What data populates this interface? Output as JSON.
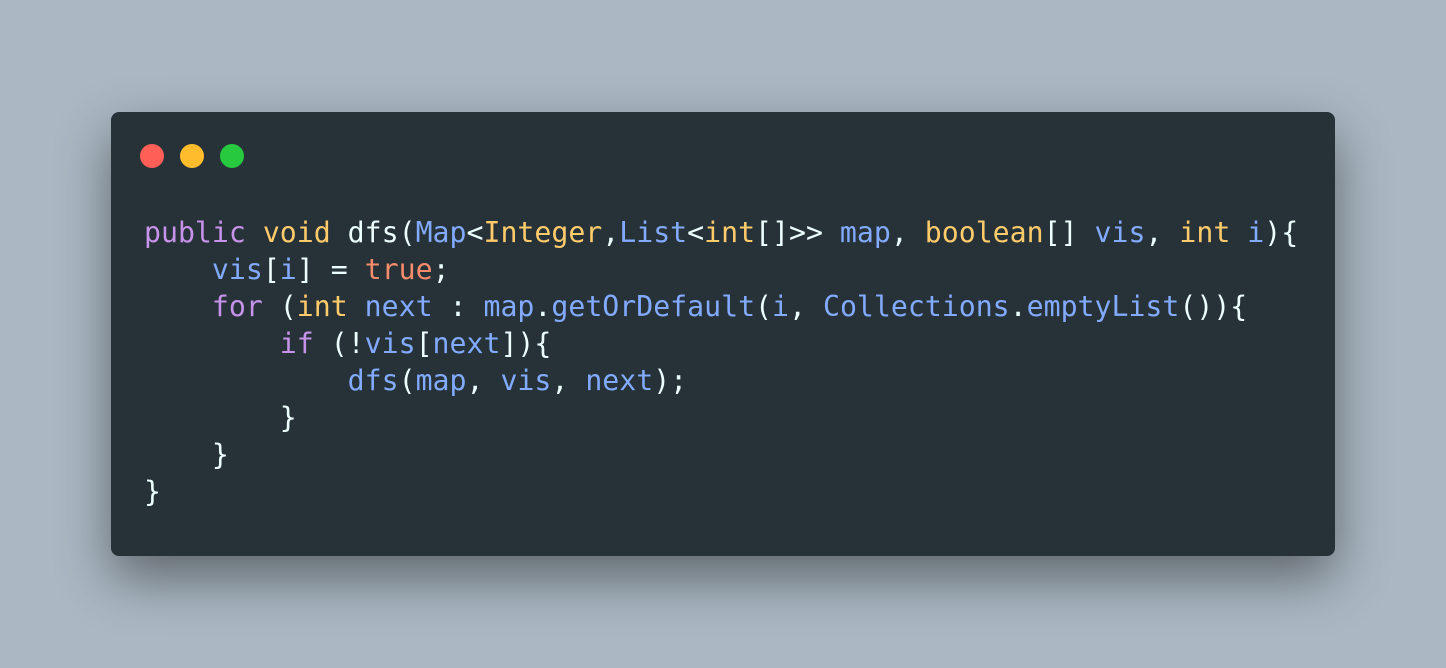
{
  "window": {
    "background": "#263238",
    "controls": [
      {
        "name": "close",
        "color": "#ff5f56"
      },
      {
        "name": "minimize",
        "color": "#ffbd2e"
      },
      {
        "name": "maximize",
        "color": "#27c93f"
      }
    ]
  },
  "theme": {
    "keyword": "#c792ea",
    "type": "#ffcb6b",
    "identifier": "#82aaff",
    "boolean": "#f78c6c",
    "punctuation": "#eeffff"
  },
  "code": {
    "language": "java",
    "lines": [
      [
        {
          "t": "public",
          "k": "keyword"
        },
        {
          "t": " ",
          "k": "punctuation"
        },
        {
          "t": "void",
          "k": "type"
        },
        {
          "t": " dfs(",
          "k": "punctuation"
        },
        {
          "t": "Map",
          "k": "identifier"
        },
        {
          "t": "<",
          "k": "punctuation"
        },
        {
          "t": "Integer",
          "k": "type"
        },
        {
          "t": ",",
          "k": "punctuation"
        },
        {
          "t": "List",
          "k": "identifier"
        },
        {
          "t": "<",
          "k": "punctuation"
        },
        {
          "t": "int",
          "k": "type"
        },
        {
          "t": "[]>> ",
          "k": "punctuation"
        },
        {
          "t": "map",
          "k": "identifier"
        },
        {
          "t": ", ",
          "k": "punctuation"
        },
        {
          "t": "boolean",
          "k": "type"
        },
        {
          "t": "[] ",
          "k": "punctuation"
        },
        {
          "t": "vis",
          "k": "identifier"
        },
        {
          "t": ", ",
          "k": "punctuation"
        },
        {
          "t": "int",
          "k": "type"
        },
        {
          "t": " ",
          "k": "punctuation"
        },
        {
          "t": "i",
          "k": "identifier"
        },
        {
          "t": "){",
          "k": "punctuation"
        }
      ],
      [
        {
          "t": "    ",
          "k": "punctuation"
        },
        {
          "t": "vis",
          "k": "identifier"
        },
        {
          "t": "[",
          "k": "punctuation"
        },
        {
          "t": "i",
          "k": "identifier"
        },
        {
          "t": "] = ",
          "k": "punctuation"
        },
        {
          "t": "true",
          "k": "boolean"
        },
        {
          "t": ";",
          "k": "punctuation"
        }
      ],
      [
        {
          "t": "    ",
          "k": "punctuation"
        },
        {
          "t": "for",
          "k": "keyword"
        },
        {
          "t": " (",
          "k": "punctuation"
        },
        {
          "t": "int",
          "k": "type"
        },
        {
          "t": " ",
          "k": "punctuation"
        },
        {
          "t": "next",
          "k": "identifier"
        },
        {
          "t": " : ",
          "k": "punctuation"
        },
        {
          "t": "map",
          "k": "identifier"
        },
        {
          "t": ".",
          "k": "punctuation"
        },
        {
          "t": "getOrDefault",
          "k": "identifier"
        },
        {
          "t": "(",
          "k": "punctuation"
        },
        {
          "t": "i",
          "k": "identifier"
        },
        {
          "t": ", ",
          "k": "punctuation"
        },
        {
          "t": "Collections",
          "k": "identifier"
        },
        {
          "t": ".",
          "k": "punctuation"
        },
        {
          "t": "emptyList",
          "k": "identifier"
        },
        {
          "t": "()){",
          "k": "punctuation"
        }
      ],
      [
        {
          "t": "        ",
          "k": "punctuation"
        },
        {
          "t": "if",
          "k": "keyword"
        },
        {
          "t": " (!",
          "k": "punctuation"
        },
        {
          "t": "vis",
          "k": "identifier"
        },
        {
          "t": "[",
          "k": "punctuation"
        },
        {
          "t": "next",
          "k": "identifier"
        },
        {
          "t": "]){",
          "k": "punctuation"
        }
      ],
      [
        {
          "t": "            ",
          "k": "punctuation"
        },
        {
          "t": "dfs",
          "k": "identifier"
        },
        {
          "t": "(",
          "k": "punctuation"
        },
        {
          "t": "map",
          "k": "identifier"
        },
        {
          "t": ", ",
          "k": "punctuation"
        },
        {
          "t": "vis",
          "k": "identifier"
        },
        {
          "t": ", ",
          "k": "punctuation"
        },
        {
          "t": "next",
          "k": "identifier"
        },
        {
          "t": ");",
          "k": "punctuation"
        }
      ],
      [
        {
          "t": "        }",
          "k": "punctuation"
        }
      ],
      [
        {
          "t": "    }",
          "k": "punctuation"
        }
      ],
      [
        {
          "t": "}",
          "k": "punctuation"
        }
      ]
    ]
  }
}
